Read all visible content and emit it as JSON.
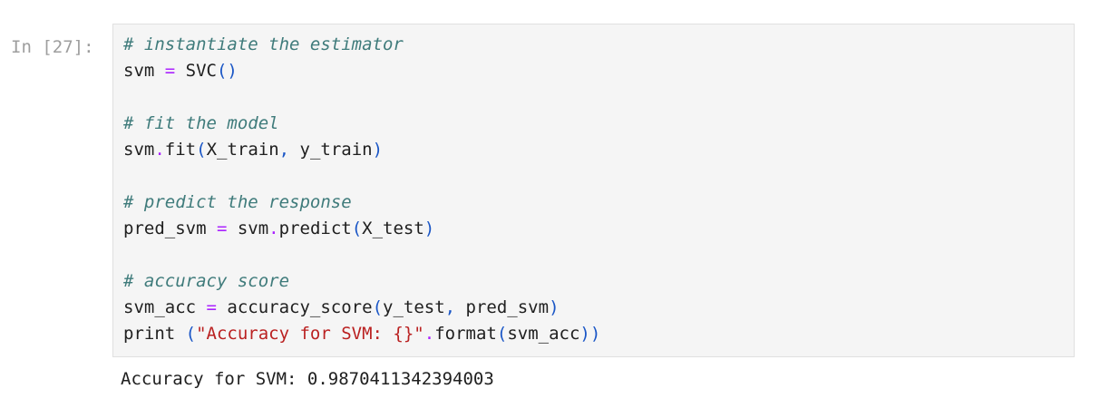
{
  "cell": {
    "prompt": "In [27]:",
    "code_lines": [
      [
        {
          "t": "comment",
          "v": "# instantiate the estimator"
        }
      ],
      [
        {
          "t": "name",
          "v": "svm "
        },
        {
          "t": "op",
          "v": "="
        },
        {
          "t": "name",
          "v": " SVC"
        },
        {
          "t": "paren",
          "v": "()"
        }
      ],
      [],
      [
        {
          "t": "comment",
          "v": "# fit the model"
        }
      ],
      [
        {
          "t": "name",
          "v": "svm"
        },
        {
          "t": "dot",
          "v": "."
        },
        {
          "t": "name",
          "v": "fit"
        },
        {
          "t": "paren",
          "v": "("
        },
        {
          "t": "name",
          "v": "X_train"
        },
        {
          "t": "paren",
          "v": ","
        },
        {
          "t": "name",
          "v": " y_train"
        },
        {
          "t": "paren",
          "v": ")"
        }
      ],
      [],
      [
        {
          "t": "comment",
          "v": "# predict the response"
        }
      ],
      [
        {
          "t": "name",
          "v": "pred_svm "
        },
        {
          "t": "op",
          "v": "="
        },
        {
          "t": "name",
          "v": " svm"
        },
        {
          "t": "dot",
          "v": "."
        },
        {
          "t": "name",
          "v": "predict"
        },
        {
          "t": "paren",
          "v": "("
        },
        {
          "t": "name",
          "v": "X_test"
        },
        {
          "t": "paren",
          "v": ")"
        }
      ],
      [],
      [
        {
          "t": "comment",
          "v": "# accuracy score"
        }
      ],
      [
        {
          "t": "name",
          "v": "svm_acc "
        },
        {
          "t": "op",
          "v": "="
        },
        {
          "t": "name",
          "v": " accuracy_score"
        },
        {
          "t": "paren",
          "v": "("
        },
        {
          "t": "name",
          "v": "y_test"
        },
        {
          "t": "paren",
          "v": ","
        },
        {
          "t": "name",
          "v": " pred_svm"
        },
        {
          "t": "paren",
          "v": ")"
        }
      ],
      [
        {
          "t": "name",
          "v": "print "
        },
        {
          "t": "paren",
          "v": "("
        },
        {
          "t": "str",
          "v": "\"Accuracy for SVM: {}\""
        },
        {
          "t": "dot",
          "v": "."
        },
        {
          "t": "name",
          "v": "format"
        },
        {
          "t": "paren",
          "v": "("
        },
        {
          "t": "name",
          "v": "svm_acc"
        },
        {
          "t": "paren",
          "v": "))"
        }
      ]
    ],
    "output": "Accuracy for SVM: 0.9870411342394003"
  },
  "colors": {
    "comment": "#3f7b7b",
    "operator": "#aa22ff",
    "paren": "#1a56c6",
    "string": "#ba2121",
    "prompt": "#9e9e9e",
    "input_bg": "#f5f5f5"
  }
}
